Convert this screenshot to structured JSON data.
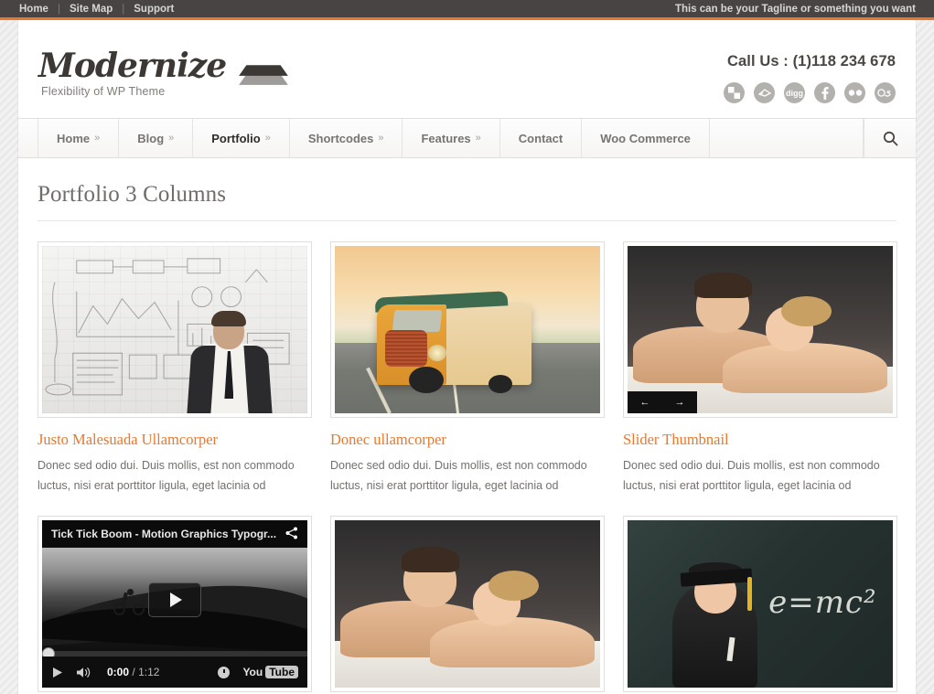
{
  "topbar": {
    "links": [
      {
        "label": "Home"
      },
      {
        "label": "Site Map"
      },
      {
        "label": "Support"
      }
    ],
    "separator": "|",
    "tagline": "This can be your Tagline or something you want",
    "accent_color": "#e8782d",
    "background_color": "#474443"
  },
  "header": {
    "logo_name": "Modernize",
    "logo_tagline": "Flexibility of WP Theme",
    "call_us": "Call Us : (1)118 234 678",
    "socials": [
      {
        "name": "delicious-icon",
        "label": "delicious"
      },
      {
        "name": "deviantart-icon",
        "label": "deviantart"
      },
      {
        "name": "digg-icon",
        "label": "digg"
      },
      {
        "name": "facebook-icon",
        "label": "f"
      },
      {
        "name": "flickr-icon",
        "label": "flickr"
      },
      {
        "name": "lastfm-icon",
        "label": "last.fm"
      }
    ]
  },
  "nav": {
    "items": [
      {
        "label": "Home",
        "caret": "»",
        "active": false
      },
      {
        "label": "Blog",
        "caret": "»",
        "active": false
      },
      {
        "label": "Portfolio",
        "caret": "»",
        "active": true
      },
      {
        "label": "Shortcodes",
        "caret": "»",
        "active": false
      },
      {
        "label": "Features",
        "caret": "»",
        "active": false
      },
      {
        "label": "Contact",
        "caret": "",
        "active": false
      },
      {
        "label": "Woo Commerce",
        "caret": "",
        "active": false
      }
    ],
    "search_icon": "search-icon"
  },
  "content": {
    "page_title": "Portfolio 3 Columns",
    "title_color": "#e8782d",
    "items": [
      {
        "title": "Justo Malesuada Ullamcorper",
        "desc": "Donec sed odio dui. Duis mollis, est non commodo luctus, nisi erat porttitor ligula, eget lacinia od",
        "media": "whiteboard-sketch-photo"
      },
      {
        "title": "Donec ullamcorper",
        "desc": "Donec sed odio dui. Duis mollis, est non commodo luctus, nisi erat porttitor ligula, eget lacinia od",
        "media": "vintage-bus-road-photo"
      },
      {
        "title": "Slider Thumbnail",
        "desc": "Donec sed odio dui. Duis mollis, est non commodo luctus, nisi erat porttitor ligula, eget lacinia od",
        "media": "spa-couple-photo",
        "slider": {
          "prev": "←",
          "next": "→"
        }
      },
      {
        "title": "",
        "desc": "",
        "media": "youtube-video-player"
      },
      {
        "title": "",
        "desc": "",
        "media": "spa-couple-photo-2"
      },
      {
        "title": "",
        "desc": "",
        "media": "graduate-boy-chalkboard-photo"
      }
    ]
  },
  "video": {
    "title": "Tick Tick Boom - Motion Graphics Typogr...",
    "share_icon": "share-icon",
    "play_icon": "play-icon",
    "volume_icon": "volume-icon",
    "current_time": "0:00",
    "separator": "/",
    "total_time": "1:12",
    "watch_later_icon": "clock-icon",
    "brand": "You",
    "brand_box": "Tube",
    "chalkboard_equation": "e=mc²"
  }
}
